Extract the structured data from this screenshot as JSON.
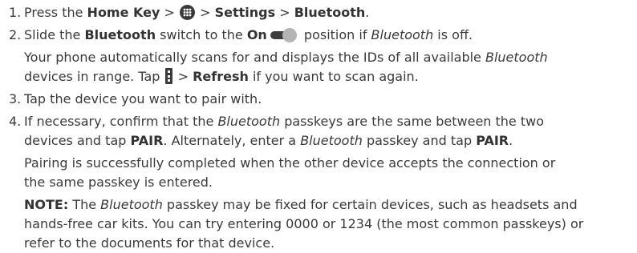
{
  "steps": [
    {
      "num": "1.",
      "press": "Press the ",
      "home_key": "Home Key",
      "sep1": " > ",
      "sep2": " > ",
      "settings": "Settings",
      "sep3": " > ",
      "bluetooth": "Bluetooth",
      "end": "."
    },
    {
      "num": "2.",
      "slide": "Slide the ",
      "bluetooth": "Bluetooth",
      "switch_to": " switch to the ",
      "on": "On",
      "position_if": " position if ",
      "bluetooth_italic": "Bluetooth",
      "is_off": " is off.",
      "scan_line1_a": "Your phone automatically scans for and displays the IDs of all available ",
      "scan_bluetooth": "Bluetooth",
      "scan_line2_a": "devices in range. Tap ",
      "scan_sep": " > ",
      "refresh": "Refresh",
      "scan_line2_b": " if you want to scan again."
    },
    {
      "num": "3.",
      "text": "Tap the device you want to pair with."
    },
    {
      "num": "4.",
      "a": "If necessary, confirm that the ",
      "bluetooth1": "Bluetooth",
      "b": " passkeys are the same between the two",
      "c": "devices and tap ",
      "pair1": "PAIR",
      "d": ". Alternately, enter a ",
      "bluetooth2": "Bluetooth",
      "e": " passkey and tap ",
      "pair2": "PAIR",
      "f": ".",
      "pairing_line1": "Pairing is successfully completed when the other device accepts the connection or",
      "pairing_line2": "the same passkey is entered.",
      "note_label": "NOTE:",
      "note_a": " The ",
      "note_bluetooth": "Bluetooth",
      "note_b": " passkey may be fixed for certain devices, such as headsets and",
      "note_line2": "hands-free car kits. You can try entering 0000 or 1234 (the most common passkeys) or",
      "note_line3": "refer to the documents for that device."
    }
  ],
  "icons": {
    "apps": "apps-grid-icon",
    "toggle": "toggle-on-icon",
    "menu": "overflow-menu-icon"
  }
}
